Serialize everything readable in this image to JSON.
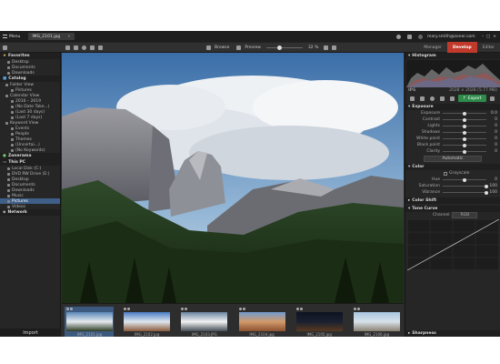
{
  "titlebar": {
    "menu_label": "Menu",
    "file_tab": "IMG_2101.jpg",
    "user_email": "mary.smith@zoner.com"
  },
  "modes": {
    "manager": "Manager",
    "develop": "Develop",
    "editor": "Editor"
  },
  "toolbar": {
    "browse": "Browse",
    "preview": "Preview",
    "zoom": "32 %"
  },
  "catalog": {
    "favorites_header": "Favorites",
    "favorites": [
      "Desktop",
      "Documents",
      "Downloads"
    ],
    "catalog_header": "Catalog",
    "catalog_items": [
      {
        "label": "Folder View"
      },
      {
        "label": "Pictures"
      },
      {
        "label": "Calendar View"
      },
      {
        "label": "2016 – 2019"
      },
      {
        "label": "(No Date Take...)"
      },
      {
        "label": "(Last 30 days)"
      },
      {
        "label": "(Last 7 days)"
      },
      {
        "label": "Keyword View"
      },
      {
        "label": "Events"
      },
      {
        "label": "People"
      },
      {
        "label": "Themes"
      },
      {
        "label": "(Uncertai...)"
      },
      {
        "label": "(No Keywords)"
      }
    ],
    "zonerama_header": "Zonerama",
    "thispc_header": "This PC",
    "pc_items": [
      {
        "label": "Local Disk (C:)",
        "selected": false
      },
      {
        "label": "DVD RW Drive (E:)",
        "selected": false
      },
      {
        "label": "Desktop",
        "selected": false
      },
      {
        "label": "Documents",
        "selected": false
      },
      {
        "label": "Downloads",
        "selected": false
      },
      {
        "label": "Music",
        "selected": false
      },
      {
        "label": "Pictures",
        "selected": true
      },
      {
        "label": "Videos",
        "selected": false
      }
    ],
    "network_header": "Network",
    "import_label": "Import"
  },
  "filmstrip": [
    {
      "name": "IMG_2101.jpg",
      "selected": true
    },
    {
      "name": "IMG_2102.jpg",
      "selected": false
    },
    {
      "name": "IMG_2103.JPG",
      "selected": false
    },
    {
      "name": "IMG_2104.jpg",
      "selected": false
    },
    {
      "name": "IMG_2105.jpg",
      "selected": false
    },
    {
      "name": "IMG_2106.jpg",
      "selected": false
    }
  ],
  "right_panel": {
    "histogram_header": "Histogram",
    "histogram_info": "2028 × 2028 (5.77 MB)",
    "export_label": "Export",
    "exposure_header": "Exposure",
    "exposure_sliders": [
      {
        "label": "Exposure",
        "value": "0.0",
        "pos": 0.5
      },
      {
        "label": "Contrast",
        "value": "0",
        "pos": 0.5
      },
      {
        "label": "Lights",
        "value": "0",
        "pos": 0.5
      },
      {
        "label": "Shadows",
        "value": "0",
        "pos": 0.5
      },
      {
        "label": "White point",
        "value": "0",
        "pos": 0.5
      },
      {
        "label": "Black point",
        "value": "0",
        "pos": 0.5
      },
      {
        "label": "Clarity",
        "value": "0",
        "pos": 0.5
      }
    ],
    "automatic_label": "Automatic",
    "color_header": "Color",
    "grayscale_label": "Grayscale",
    "color_sliders": [
      {
        "label": "Hue",
        "value": "0",
        "pos": 0.5
      },
      {
        "label": "Saturation",
        "value": "100",
        "pos": 1.0
      },
      {
        "label": "Vibrance",
        "value": "100",
        "pos": 1.0
      }
    ],
    "color_shift_header": "Color Shift",
    "tone_curve_header": "Tone Curve",
    "channel_label": "Channel",
    "channel_value": "RGB",
    "sharpness_header": "Sharpness"
  }
}
